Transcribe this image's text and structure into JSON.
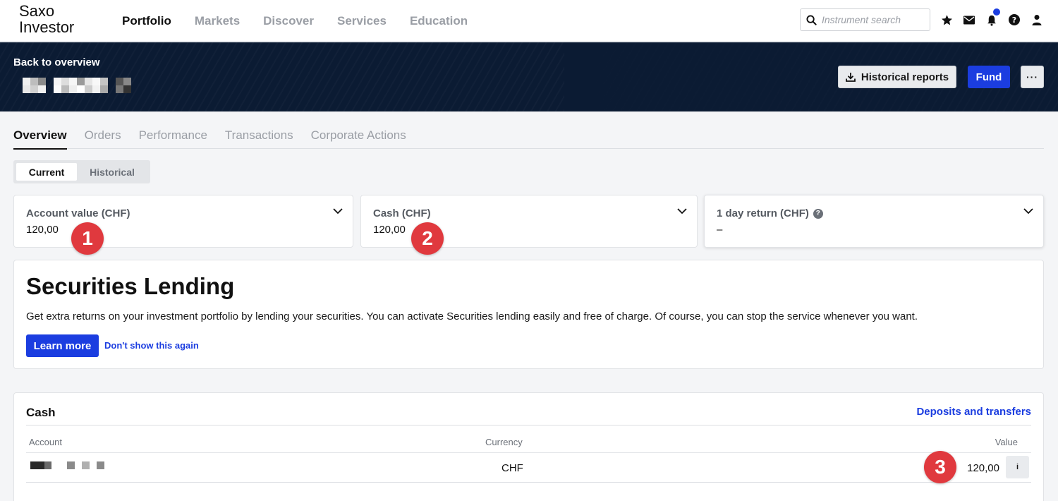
{
  "brand": {
    "line1": "Saxo",
    "line2": "Investor"
  },
  "nav": {
    "items": [
      "Portfolio",
      "Markets",
      "Discover",
      "Services",
      "Education"
    ],
    "active": "Portfolio"
  },
  "search": {
    "placeholder": "Instrument search"
  },
  "top_icons": [
    "star-icon",
    "mail-icon",
    "notification-icon",
    "help-icon",
    "user-icon"
  ],
  "banner": {
    "back_label": "Back to overview",
    "historical_reports_label": "Historical reports",
    "fund_label": "Fund",
    "more_label": "···"
  },
  "tabs": [
    "Overview",
    "Orders",
    "Performance",
    "Transactions",
    "Corporate Actions"
  ],
  "segmented": {
    "current": "Current",
    "historical": "Historical"
  },
  "kpis": [
    {
      "label": "Account value (CHF)",
      "value": "120,00"
    },
    {
      "label": "Cash (CHF)",
      "value": "120,00"
    },
    {
      "label": "1 day return (CHF)",
      "value": "–"
    }
  ],
  "markers": [
    "1",
    "2",
    "3"
  ],
  "securities_lending": {
    "title": "Securities Lending",
    "text": "Get extra returns on your investment portfolio by lending your securities. You can activate Securities lending easily and free of charge. Of course, you can stop the service whenever you want.",
    "learn_more": "Learn more",
    "dont_show": "Don't show this again"
  },
  "cash": {
    "title": "Cash",
    "link": "Deposits and transfers",
    "columns": {
      "account": "Account",
      "currency": "Currency",
      "value": "Value"
    },
    "rows": [
      {
        "currency": "CHF",
        "value": "120,00"
      }
    ],
    "info_label": "i"
  },
  "colors": {
    "accent": "#1b3de0",
    "banner": "#0b1b33",
    "marker": "#e0393e"
  }
}
